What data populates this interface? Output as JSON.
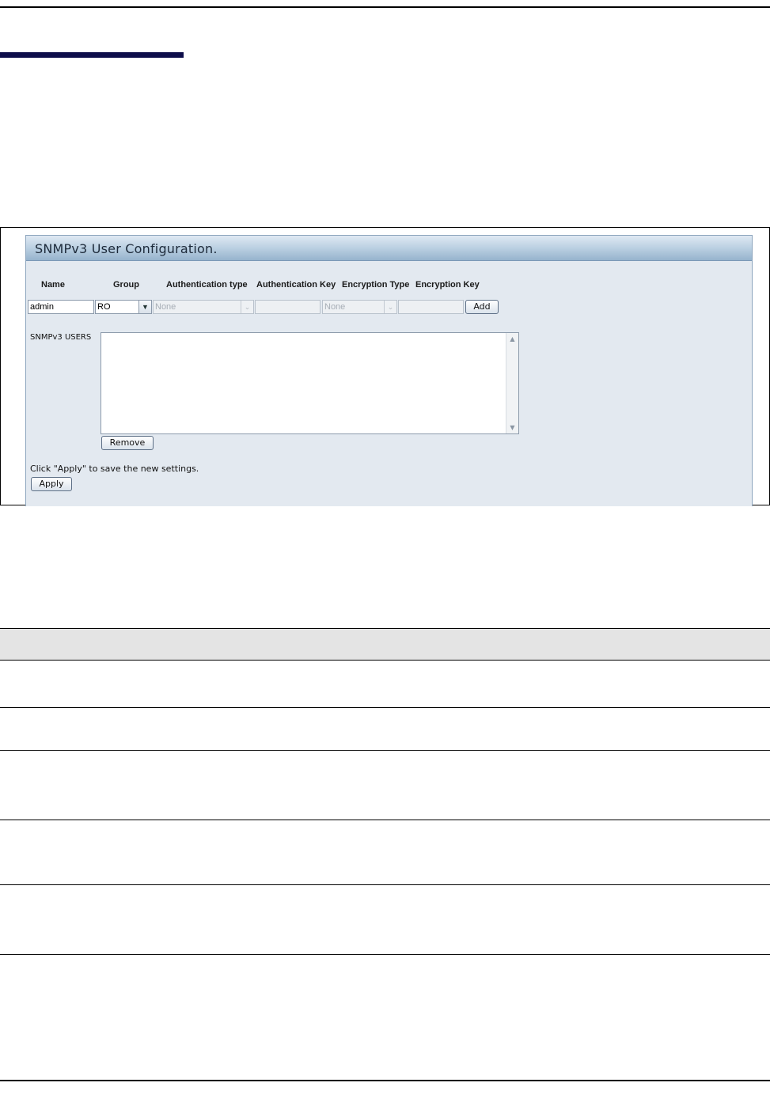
{
  "panel": {
    "title": "SNMPv3 User Configuration."
  },
  "columns": {
    "name": "Name",
    "group": "Group",
    "auth_type": "Authentication type",
    "auth_key": "Authentication Key",
    "enc_type": "Encryption Type",
    "enc_key": "Encryption Key"
  },
  "form": {
    "name_value": "admin",
    "group_value": "RO",
    "auth_type_value": "None",
    "auth_key_value": "",
    "enc_type_value": "None",
    "enc_key_value": "",
    "add_label": "Add"
  },
  "users": {
    "label": "SNMPv3 USERS",
    "items": [],
    "remove_label": "Remove"
  },
  "footer": {
    "apply_note": "Click \"Apply\" to save the new settings.",
    "apply_label": "Apply"
  },
  "colors": {
    "panel_background": "#e3e9f0",
    "header_gradient_bottom": "#96b3cd",
    "section_bar": "#0d0d4a",
    "table_header": "#e4e4e4"
  },
  "icons": {
    "dropdown": "chevron-down-icon",
    "scroll_up": "arrow-up-icon",
    "scroll_down": "arrow-down-icon"
  }
}
